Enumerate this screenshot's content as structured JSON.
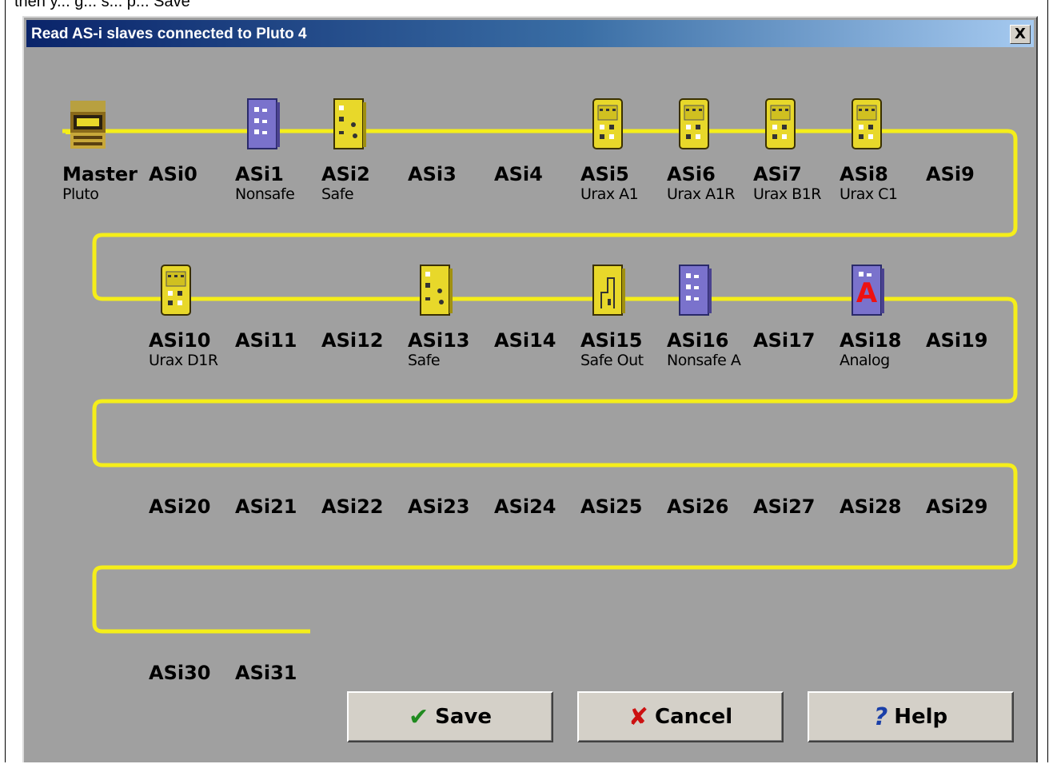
{
  "top_text": "then y... g... s... p... Save",
  "window": {
    "title": "Read AS-i slaves connected to Pluto 4",
    "close_label": "X"
  },
  "master": {
    "name": "Master",
    "sub": "Pluto"
  },
  "slaves": [
    {
      "name": "ASi0",
      "sub": ""
    },
    {
      "name": "ASi1",
      "sub": "Nonsafe"
    },
    {
      "name": "ASi2",
      "sub": "Safe"
    },
    {
      "name": "ASi3",
      "sub": ""
    },
    {
      "name": "ASi4",
      "sub": ""
    },
    {
      "name": "ASi5",
      "sub": "Urax A1"
    },
    {
      "name": "ASi6",
      "sub": "Urax A1R"
    },
    {
      "name": "ASi7",
      "sub": "Urax B1R"
    },
    {
      "name": "ASi8",
      "sub": "Urax C1"
    },
    {
      "name": "ASi9",
      "sub": ""
    },
    {
      "name": "ASi10",
      "sub": "Urax D1R"
    },
    {
      "name": "ASi11",
      "sub": ""
    },
    {
      "name": "ASi12",
      "sub": ""
    },
    {
      "name": "ASi13",
      "sub": "Safe"
    },
    {
      "name": "ASi14",
      "sub": ""
    },
    {
      "name": "ASi15",
      "sub": "Safe Out"
    },
    {
      "name": "ASi16",
      "sub": "Nonsafe A"
    },
    {
      "name": "ASi17",
      "sub": ""
    },
    {
      "name": "ASi18",
      "sub": "Analog"
    },
    {
      "name": "ASi19",
      "sub": ""
    },
    {
      "name": "ASi20",
      "sub": ""
    },
    {
      "name": "ASi21",
      "sub": ""
    },
    {
      "name": "ASi22",
      "sub": ""
    },
    {
      "name": "ASi23",
      "sub": ""
    },
    {
      "name": "ASi24",
      "sub": ""
    },
    {
      "name": "ASi25",
      "sub": ""
    },
    {
      "name": "ASi26",
      "sub": ""
    },
    {
      "name": "ASi27",
      "sub": ""
    },
    {
      "name": "ASi28",
      "sub": ""
    },
    {
      "name": "ASi29",
      "sub": ""
    },
    {
      "name": "ASi30",
      "sub": ""
    },
    {
      "name": "ASi31",
      "sub": ""
    }
  ],
  "buttons": {
    "save": {
      "label": "Save",
      "icon": "checkmark-icon",
      "icon_color": "#1f8a1f"
    },
    "cancel": {
      "label": "Cancel",
      "icon": "red-x-icon",
      "icon_color": "#cc1111"
    },
    "help": {
      "label": "Help",
      "icon": "question-mark-icon",
      "icon_color": "#1a3fa8"
    }
  },
  "colors": {
    "bus": "#f5ee1a",
    "panel": "#a0a0a0",
    "safe_module": "#e8d82a",
    "nonsafe_module": "#7a72cc"
  }
}
